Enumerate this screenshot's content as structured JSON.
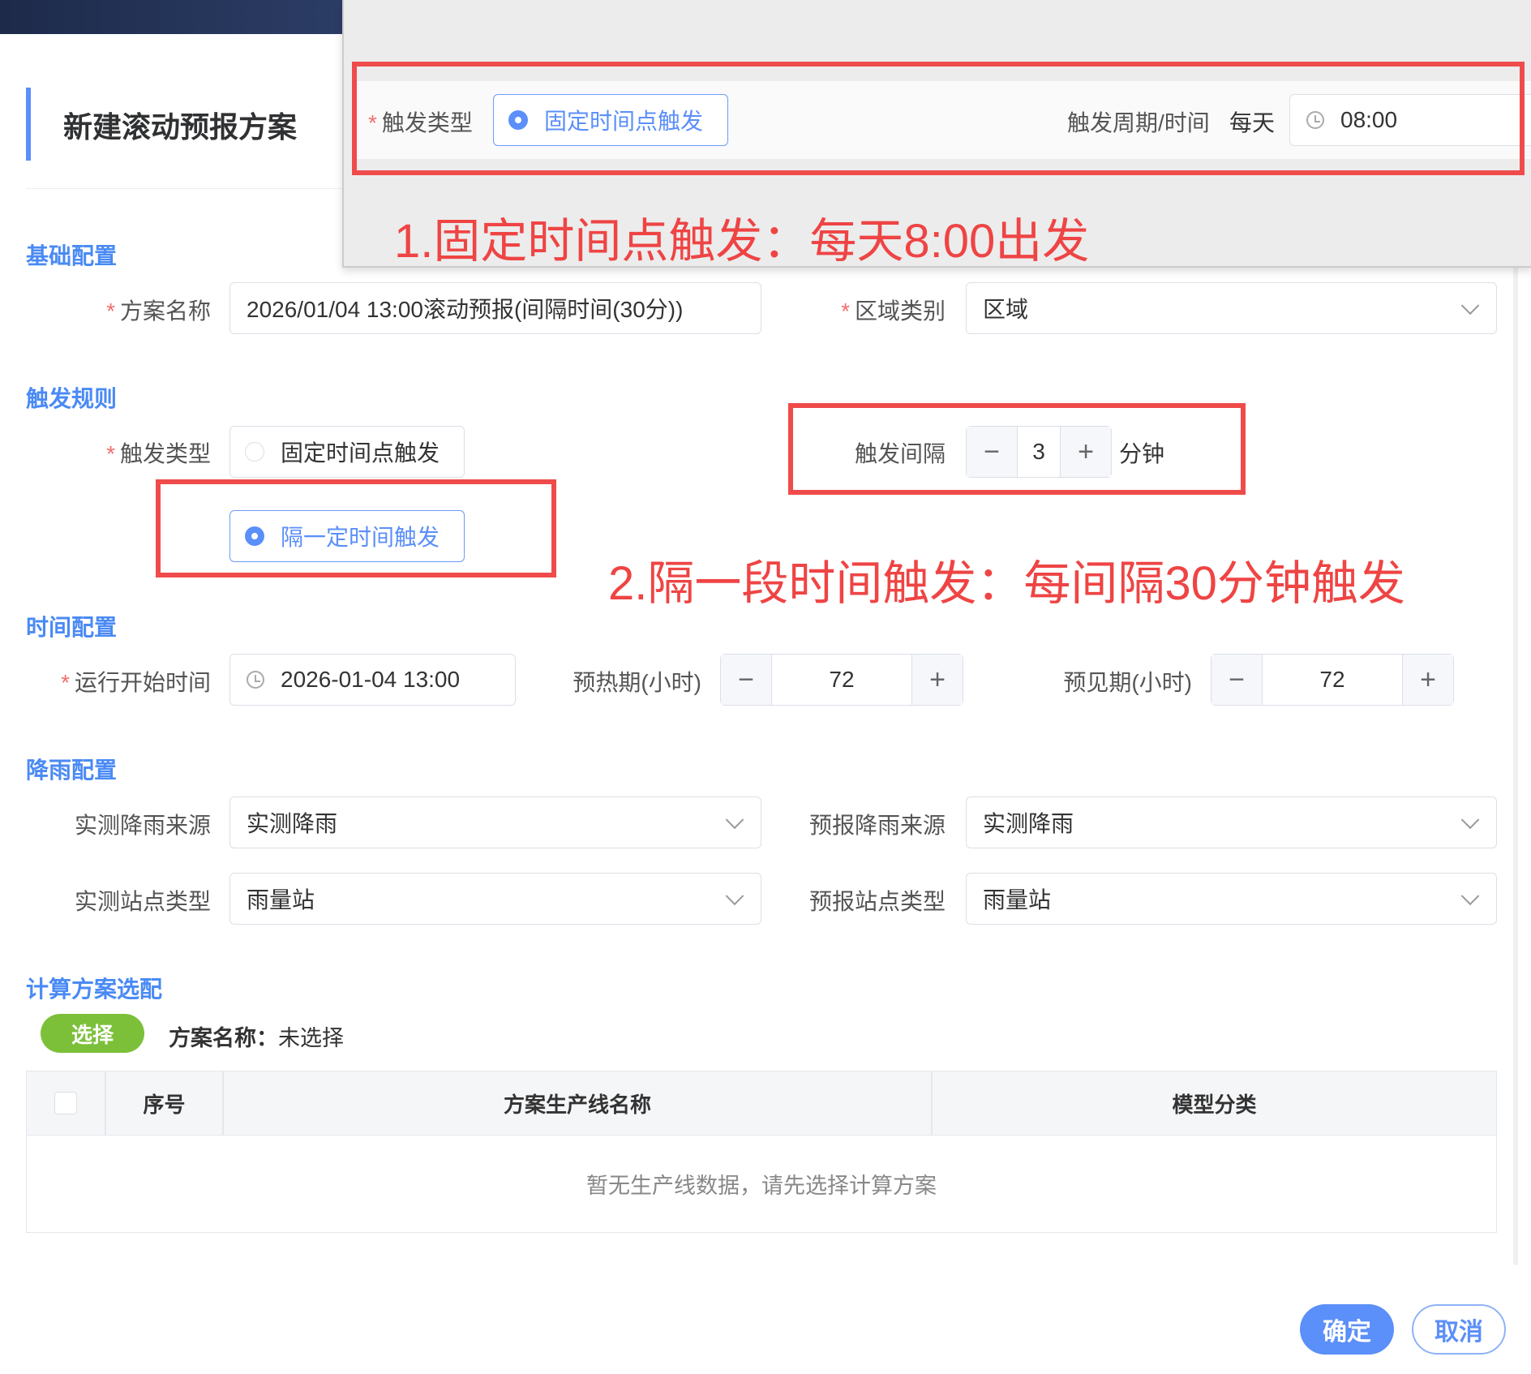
{
  "dialog": {
    "title": "新建滚动预报方案"
  },
  "sections": {
    "basic": "基础配置",
    "trigger": "触发规则",
    "time": "时间配置",
    "rain": "降雨配置",
    "calc": "计算方案选配"
  },
  "basic": {
    "scheme_name_label": "方案名称",
    "scheme_name_value": "2026/01/04 13:00滚动预报(间隔时间(30分))",
    "region_type_label": "区域类别",
    "region_type_value": "区域"
  },
  "trigger": {
    "type_label": "触发类型",
    "option_fixed": "固定时间点触发",
    "option_interval": "隔一定时间触发",
    "interval_label": "触发间隔",
    "interval_value": "3",
    "interval_unit": "分钟",
    "selected": "interval"
  },
  "time": {
    "start_label": "运行开始时间",
    "start_value": "2026-01-04 13:00",
    "warmup_label": "预热期(小时)",
    "warmup_value": "72",
    "forecast_label": "预见期(小时)",
    "forecast_value": "72"
  },
  "rain": {
    "obs_source_label": "实测降雨来源",
    "obs_source_value": "实测降雨",
    "fc_source_label": "预报降雨来源",
    "fc_source_value": "实测降雨",
    "obs_station_label": "实测站点类型",
    "obs_station_value": "雨量站",
    "fc_station_label": "预报站点类型",
    "fc_station_value": "雨量站"
  },
  "calc": {
    "select_button": "选择",
    "scheme_label": "方案名称：",
    "scheme_value": "未选择",
    "table": {
      "headers": [
        "序号",
        "方案生产线名称",
        "模型分类"
      ],
      "empty_text": "暂无生产线数据，请先选择计算方案"
    }
  },
  "footer": {
    "confirm": "确定",
    "cancel": "取消"
  },
  "callout": {
    "type_label": "触发类型",
    "option_fixed": "固定时间点触发",
    "period_label": "触发周期/时间",
    "period_value": "每天",
    "time_value": "08:00",
    "annotation_1": "1.固定时间点触发：每天8:00出发",
    "annotation_2": "2.隔一段时间触发：每间隔30分钟触发"
  },
  "colors": {
    "accent": "#5b8ff9",
    "annotation": "#ef4444",
    "select_button": "#7cc03a"
  }
}
